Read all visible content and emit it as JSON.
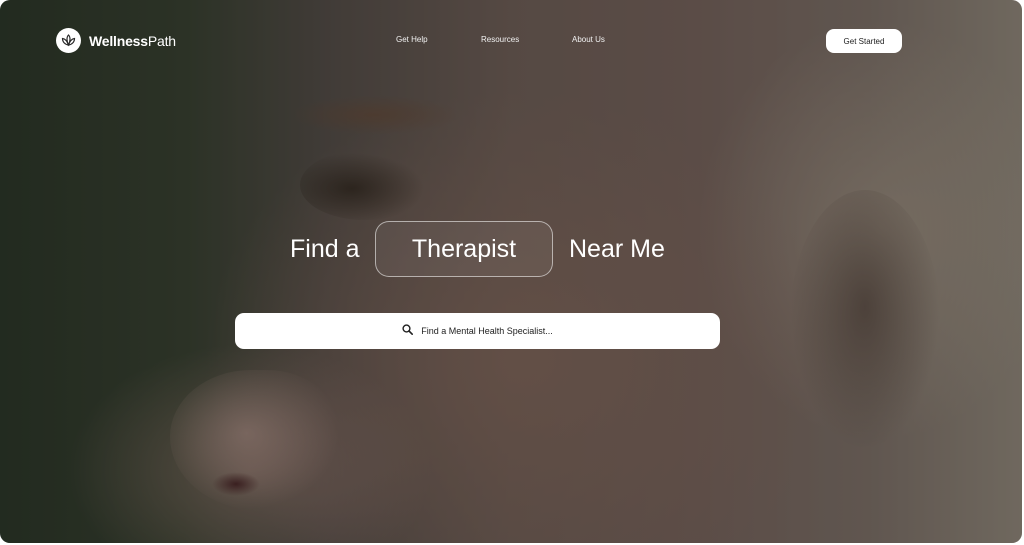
{
  "brand": {
    "name_bold": "Wellness",
    "name_regular": "Path"
  },
  "nav": {
    "items": [
      "Get Help",
      "Resources",
      "About Us"
    ]
  },
  "header": {
    "cta_label": "Get Started"
  },
  "hero": {
    "headline_prefix": "Find a",
    "headline_highlight": "Therapist",
    "headline_suffix": "Near Me"
  },
  "search": {
    "placeholder": "Find a Mental Health Specialist..."
  },
  "icons": {
    "logo": "lotus-icon",
    "search": "search-icon"
  },
  "colors": {
    "cta_bg": "#ffffff",
    "text_on_image": "#ffffff",
    "search_bg": "#ffffff"
  }
}
